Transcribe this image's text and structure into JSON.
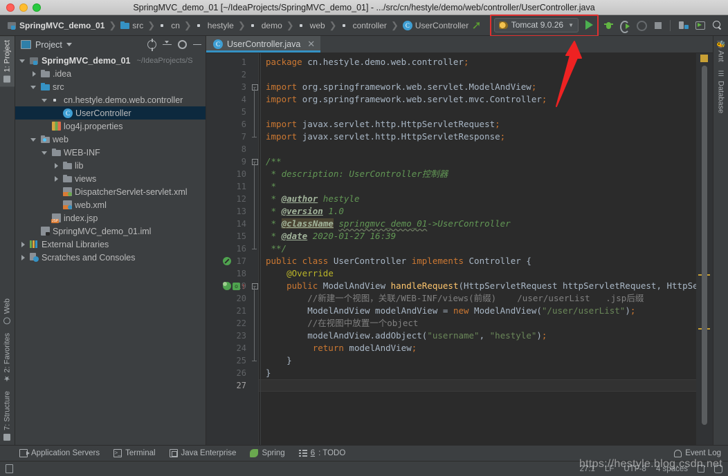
{
  "window": {
    "title": "SpringMVC_demo_01 [~/IdeaProjects/SpringMVC_demo_01] - .../src/cn/hestyle/demo/web/controller/UserController.java"
  },
  "breadcrumb": [
    {
      "label": "SpringMVC_demo_01",
      "icon": "module-icon"
    },
    {
      "label": "src",
      "icon": "folder-blue-icon"
    },
    {
      "label": "cn",
      "icon": "package-icon"
    },
    {
      "label": "hestyle",
      "icon": "package-icon"
    },
    {
      "label": "demo",
      "icon": "package-icon"
    },
    {
      "label": "web",
      "icon": "package-icon"
    },
    {
      "label": "controller",
      "icon": "package-icon"
    },
    {
      "label": "UserController",
      "icon": "java-class-icon"
    }
  ],
  "toolbar": {
    "run_config": "Tomcat 9.0.26",
    "icons": [
      "back-arrow-icon",
      "run-icon",
      "debug-icon",
      "run-coverage-icon",
      "attach-profiler-icon",
      "stop-icon",
      "project-structure-icon",
      "preview-icon",
      "search-everywhere-icon"
    ]
  },
  "project_panel": {
    "title": "Project",
    "tools": [
      "locate-icon",
      "collapse-all-icon",
      "settings-icon",
      "hide-icon"
    ],
    "tree": [
      {
        "label": "SpringMVC_demo_01",
        "path": "~/IdeaProjects/S",
        "indent": 0,
        "arrow": "open",
        "icon": "module-icon",
        "bold": true,
        "selected": false
      },
      {
        "label": ".idea",
        "path": "",
        "indent": 1,
        "arrow": "closed",
        "icon": "folder-icon",
        "bold": false,
        "selected": false
      },
      {
        "label": "src",
        "path": "",
        "indent": 1,
        "arrow": "open",
        "icon": "folder-blue-icon",
        "bold": false,
        "selected": false
      },
      {
        "label": "cn.hestyle.demo.web.controller",
        "path": "",
        "indent": 2,
        "arrow": "open",
        "icon": "package-icon",
        "bold": false,
        "selected": false
      },
      {
        "label": "UserController",
        "path": "",
        "indent": 3,
        "arrow": "none",
        "icon": "java-class-icon",
        "bold": false,
        "selected": true
      },
      {
        "label": "log4j.properties",
        "path": "",
        "indent": 2,
        "arrow": "none",
        "icon": "properties-icon",
        "bold": false,
        "selected": false
      },
      {
        "label": "web",
        "path": "",
        "indent": 1,
        "arrow": "open",
        "icon": "web-folder-icon",
        "bold": false,
        "selected": false
      },
      {
        "label": "WEB-INF",
        "path": "",
        "indent": 2,
        "arrow": "open",
        "icon": "folder-icon",
        "bold": false,
        "selected": false
      },
      {
        "label": "lib",
        "path": "",
        "indent": 3,
        "arrow": "closed",
        "icon": "folder-icon",
        "bold": false,
        "selected": false
      },
      {
        "label": "views",
        "path": "",
        "indent": 3,
        "arrow": "closed",
        "icon": "folder-icon",
        "bold": false,
        "selected": false
      },
      {
        "label": "DispatcherServlet-servlet.xml",
        "path": "",
        "indent": 3,
        "arrow": "none",
        "icon": "spring-xml-icon",
        "bold": false,
        "selected": false
      },
      {
        "label": "web.xml",
        "path": "",
        "indent": 3,
        "arrow": "none",
        "icon": "xml-icon",
        "bold": false,
        "selected": false
      },
      {
        "label": "index.jsp",
        "path": "",
        "indent": 2,
        "arrow": "none",
        "icon": "jsp-icon",
        "bold": false,
        "selected": false
      },
      {
        "label": "SpringMVC_demo_01.iml",
        "path": "",
        "indent": 1,
        "arrow": "none",
        "icon": "iml-icon",
        "bold": false,
        "selected": false
      },
      {
        "label": "External Libraries",
        "path": "",
        "indent": 0,
        "arrow": "closed",
        "icon": "libraries-icon",
        "bold": false,
        "selected": false
      },
      {
        "label": "Scratches and Consoles",
        "path": "",
        "indent": 0,
        "arrow": "closed",
        "icon": "scratches-icon",
        "bold": false,
        "selected": false
      }
    ]
  },
  "left_stripe": [
    {
      "label": "1: Project",
      "icon": "project-icon",
      "active": true
    },
    {
      "label": "Web",
      "icon": "globe-icon",
      "active": false
    },
    {
      "label": "2: Favorites",
      "icon": "star-icon",
      "active": false
    },
    {
      "label": "7: Structure",
      "icon": "structure-icon",
      "active": false
    }
  ],
  "right_stripe": [
    {
      "label": "Ant",
      "icon": "ant-icon"
    },
    {
      "label": "Database",
      "icon": "database-icon"
    }
  ],
  "editor": {
    "tab": "UserController.java",
    "tab_icon": "java-class-icon",
    "current_line": 27,
    "total_lines": 27,
    "code_lines": [
      {
        "n": 1,
        "html": "<span class=\"kw\">package</span> <span class=\"id\">cn.hestyle.demo.web.controller</span><span class=\"kw\">;</span>"
      },
      {
        "n": 2,
        "html": ""
      },
      {
        "n": 3,
        "html": "<span class=\"kw\">import</span> <span class=\"id\">org.springframework.web.servlet.ModelAndView</span><span class=\"kw\">;</span>"
      },
      {
        "n": 4,
        "html": "<span class=\"kw\">import</span> <span class=\"id\">org.springframework.web.servlet.mvc.Controller</span><span class=\"kw\">;</span>"
      },
      {
        "n": 5,
        "html": ""
      },
      {
        "n": 6,
        "html": "<span class=\"kw\">import</span> <span class=\"id\">javax.servlet.http.HttpServletRequest</span><span class=\"kw\">;</span>"
      },
      {
        "n": 7,
        "html": "<span class=\"kw\">import</span> <span class=\"id\">javax.servlet.http.HttpServletResponse</span><span class=\"kw\">;</span>"
      },
      {
        "n": 8,
        "html": ""
      },
      {
        "n": 9,
        "html": "<span class=\"doc\">/**</span>"
      },
      {
        "n": 10,
        "html": "<span class=\"doc\"> * description: UserController控制器</span>"
      },
      {
        "n": 11,
        "html": "<span class=\"doc\"> *</span>"
      },
      {
        "n": 12,
        "html": "<span class=\"doc\"> * <span class=\"doctag\">@author</span> hestyle</span>"
      },
      {
        "n": 13,
        "html": "<span class=\"doc\"> * <span class=\"doctag\">@version</span> 1.0</span>"
      },
      {
        "n": 14,
        "html": "<span class=\"doc\"> * <span class=\"doctag hl\">@className</span> <span class=\"wavy\">springmvc_demo_01</span>-&gt;UserController</span>"
      },
      {
        "n": 15,
        "html": "<span class=\"doc\"> * <span class=\"doctag\">@date</span> 2020-01-27 16:39</span>"
      },
      {
        "n": 16,
        "html": "<span class=\"doc\"> **/</span>"
      },
      {
        "n": 17,
        "html": "<span class=\"kw\">public class </span><span class=\"id\">UserController </span><span class=\"kw\">implements </span><span class=\"id\">Controller {</span>"
      },
      {
        "n": 18,
        "html": "    <span class=\"ann\">@Override</span>"
      },
      {
        "n": 19,
        "html": "    <span class=\"kw\">public </span><span class=\"id\">ModelAndView </span><span class=\"mth\">handleRequest</span><span class=\"id\">(HttpServletRequest httpServletRequest, HttpServletRespon</span>"
      },
      {
        "n": 20,
        "html": "        <span class=\"cmt\">//新建一个视图，关联/WEB-INF/views(前缀)    /user/userList   .jsp后缀</span>"
      },
      {
        "n": 21,
        "html": "        <span class=\"id\">ModelAndView modelAndView = </span><span class=\"kw\">new </span><span class=\"id\">ModelAndView(</span><span class=\"str\">\"/user/userList\"</span><span class=\"id\">)</span><span class=\"kw\">;</span>"
      },
      {
        "n": 22,
        "html": "        <span class=\"cmt\">//在视图中放置一个object</span>"
      },
      {
        "n": 23,
        "html": "        <span class=\"id\">modelAndView.addObject(</span><span class=\"str\">\"username\"</span><span class=\"id\">, </span><span class=\"str\">\"hestyle\"</span><span class=\"id\">)</span><span class=\"kw\">;</span>"
      },
      {
        "n": 24,
        "html": "         <span class=\"kw\">return </span><span class=\"id\">modelAndView</span><span class=\"kw\">;</span>"
      },
      {
        "n": 25,
        "html": "    <span class=\"id\">}</span>"
      },
      {
        "n": 26,
        "html": "<span class=\"id\">}</span>"
      },
      {
        "n": 27,
        "html": ""
      }
    ]
  },
  "bottom_tools": [
    {
      "label": "Application Servers",
      "icon": "app-servers-icon",
      "mnemonic": ""
    },
    {
      "label": "Terminal",
      "icon": "terminal-icon",
      "mnemonic": ""
    },
    {
      "label": "Java Enterprise",
      "icon": "java-enterprise-icon",
      "mnemonic": ""
    },
    {
      "label": "Spring",
      "icon": "spring-icon",
      "mnemonic": ""
    },
    {
      "label": ": TODO",
      "icon": "todo-icon",
      "mnemonic": "6"
    }
  ],
  "event_log": {
    "label": "Event Log",
    "icon": "event-log-icon"
  },
  "status_bar": {
    "caret": "27:1",
    "line_separator": "LF",
    "encoding": "UTF-8",
    "indent": "4 spaces",
    "icons": [
      "lock-icon",
      "face-icon"
    ]
  },
  "watermark": "https://hestyle.blog.csdn.net",
  "colors": {
    "accent_blue": "#3592c4",
    "run_green": "#4caf50",
    "annotation_red": "#e03030",
    "selection_blue": "#0d293e",
    "editor_bg": "#2b2b2b",
    "panel_bg": "#3c3f41"
  }
}
